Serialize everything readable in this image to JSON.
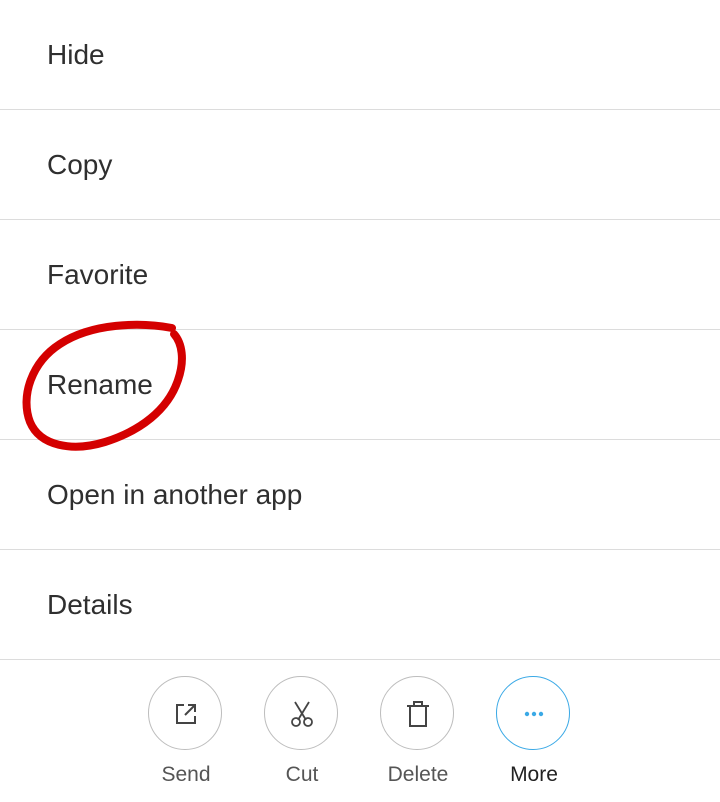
{
  "menu": {
    "items": [
      {
        "label": "Hide"
      },
      {
        "label": "Copy"
      },
      {
        "label": "Favorite"
      },
      {
        "label": "Rename"
      },
      {
        "label": "Open in another app"
      },
      {
        "label": "Details"
      }
    ]
  },
  "bottom_bar": {
    "actions": [
      {
        "label": "Send",
        "icon": "send-icon"
      },
      {
        "label": "Cut",
        "icon": "scissors-icon"
      },
      {
        "label": "Delete",
        "icon": "trash-icon"
      },
      {
        "label": "More",
        "icon": "more-dots-icon"
      }
    ]
  },
  "colors": {
    "annotation": "#d40000",
    "more_accent": "#3aa9e6",
    "divider": "#dcdcdc"
  }
}
